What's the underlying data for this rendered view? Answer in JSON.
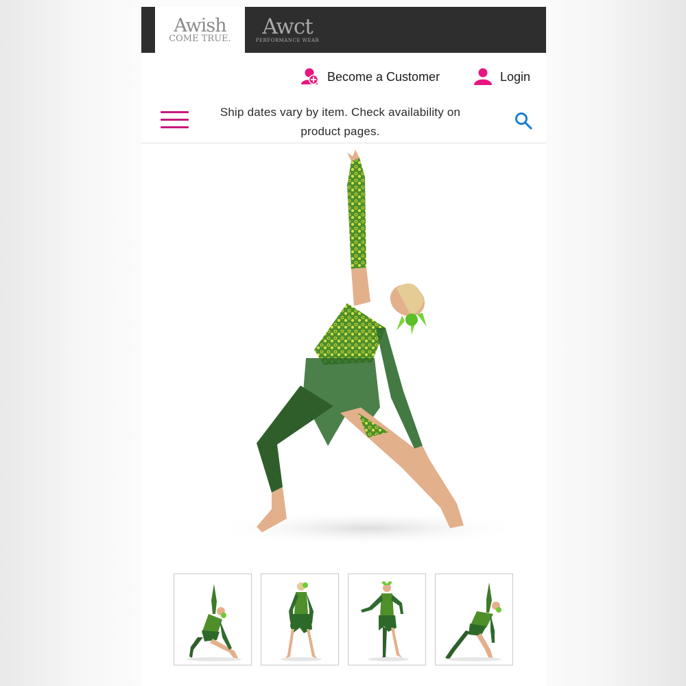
{
  "brands": [
    {
      "line1": "Awish",
      "line2": "COME TRUE."
    },
    {
      "line1": "Awct",
      "line2": "PERFORMANCE WEAR"
    }
  ],
  "account": {
    "become_customer": "Become a Customer",
    "login": "Login"
  },
  "notice": {
    "text": "Ship dates vary by item. Check availability on product pages."
  },
  "colors": {
    "accent": "#c8197e",
    "icon_pink": "#e6157f",
    "search": "#1a7fd6",
    "header_dark": "#2e2e2e"
  },
  "icons": [
    "menu-icon",
    "search-icon",
    "add-user-icon",
    "user-icon"
  ]
}
